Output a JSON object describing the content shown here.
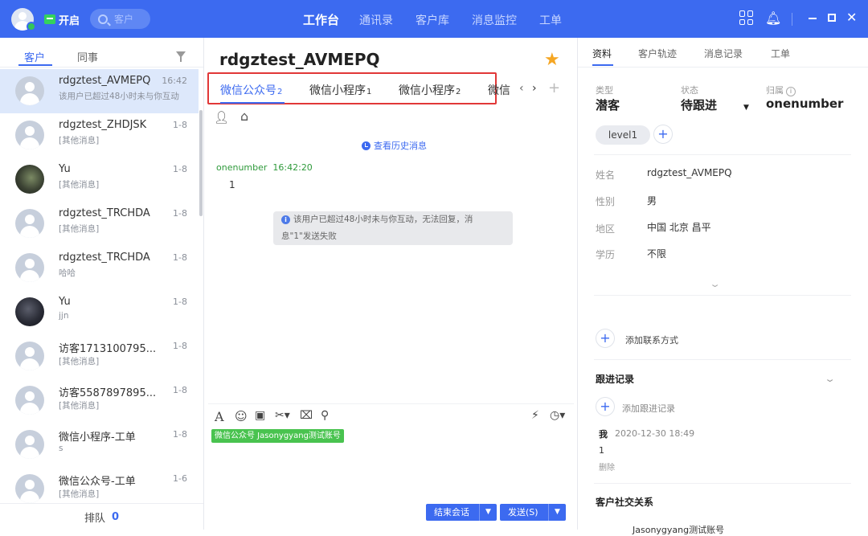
{
  "topbar": {
    "open_label": "开启",
    "search_placeholder": "客户",
    "nav": [
      "工作台",
      "通讯录",
      "客户库",
      "消息监控",
      "工单"
    ],
    "active_nav": "工作台"
  },
  "left": {
    "tabs": [
      "客户",
      "同事"
    ],
    "conversations": [
      {
        "name": "rdgztest_AVMEPQ",
        "sub": "该用户已超过48小时未与你互动",
        "time": "16:42"
      },
      {
        "name": "rdgztest_ZHDJSK",
        "sub": "[其他消息]",
        "time": "1-8"
      },
      {
        "name": "Yu",
        "sub": "[其他消息]",
        "time": "1-8"
      },
      {
        "name": "rdgztest_TRCHDA",
        "sub": "[其他消息]",
        "time": "1-8"
      },
      {
        "name": "rdgztest_TRCHDA",
        "sub": "哈哈",
        "time": "1-8"
      },
      {
        "name": "Yu",
        "sub": "jjn",
        "time": "1-8"
      },
      {
        "name": "访客1713100795...",
        "sub": "[其他消息]",
        "time": "1-8"
      },
      {
        "name": "访客5587897895...",
        "sub": "[其他消息]",
        "time": "1-8"
      },
      {
        "name": "微信小程序-工单",
        "sub": "s",
        "time": "1-8"
      },
      {
        "name": "微信公众号-工单",
        "sub": "[其他消息]",
        "time": "1-6"
      }
    ],
    "queue_label": "排队",
    "queue_count": "0"
  },
  "chat": {
    "title": "rdgztest_AVMEPQ",
    "channel_tabs": [
      {
        "label": "微信公众号",
        "count": "2"
      },
      {
        "label": "微信小程序",
        "count": "1"
      },
      {
        "label": "微信小程序",
        "count": "2"
      },
      {
        "label": "微信",
        "count": ""
      }
    ],
    "history_link": "查看历史消息",
    "sender": "onenumber",
    "sent_time": "16:42:20",
    "message": "1",
    "system_notice_line1": "该用户已超过48小时未与你互动，无法回复，消",
    "system_notice_line2": "息\"1\"发送失败",
    "account_tag": "微信公众号 Jasonygyang测试账号",
    "end_button": "结束会话",
    "send_button": "发送(S)"
  },
  "profile": {
    "tabs": [
      "资料",
      "客户轨迹",
      "消息记录",
      "工单"
    ],
    "type_label": "类型",
    "type_value": "潜客",
    "status_label": "状态",
    "status_value": "待跟进",
    "owner_label": "归属",
    "owner_value": "onenumber",
    "level_tag": "level1",
    "fields": [
      {
        "label": "姓名",
        "value": "rdgztest_AVMEPQ"
      },
      {
        "label": "性别",
        "value": "男"
      },
      {
        "label": "地区",
        "value": "中国 北京 昌平"
      },
      {
        "label": "学历",
        "value": "不限"
      }
    ],
    "add_contact": "添加联系方式",
    "followup_title": "跟进记录",
    "add_followup": "添加跟进记录",
    "record_who": "我",
    "record_date": "2020-12-30 18:49",
    "record_content": "1",
    "record_delete": "删除",
    "social_title": "客户社交关系",
    "social_item": "Jasonygyang测试账号"
  }
}
